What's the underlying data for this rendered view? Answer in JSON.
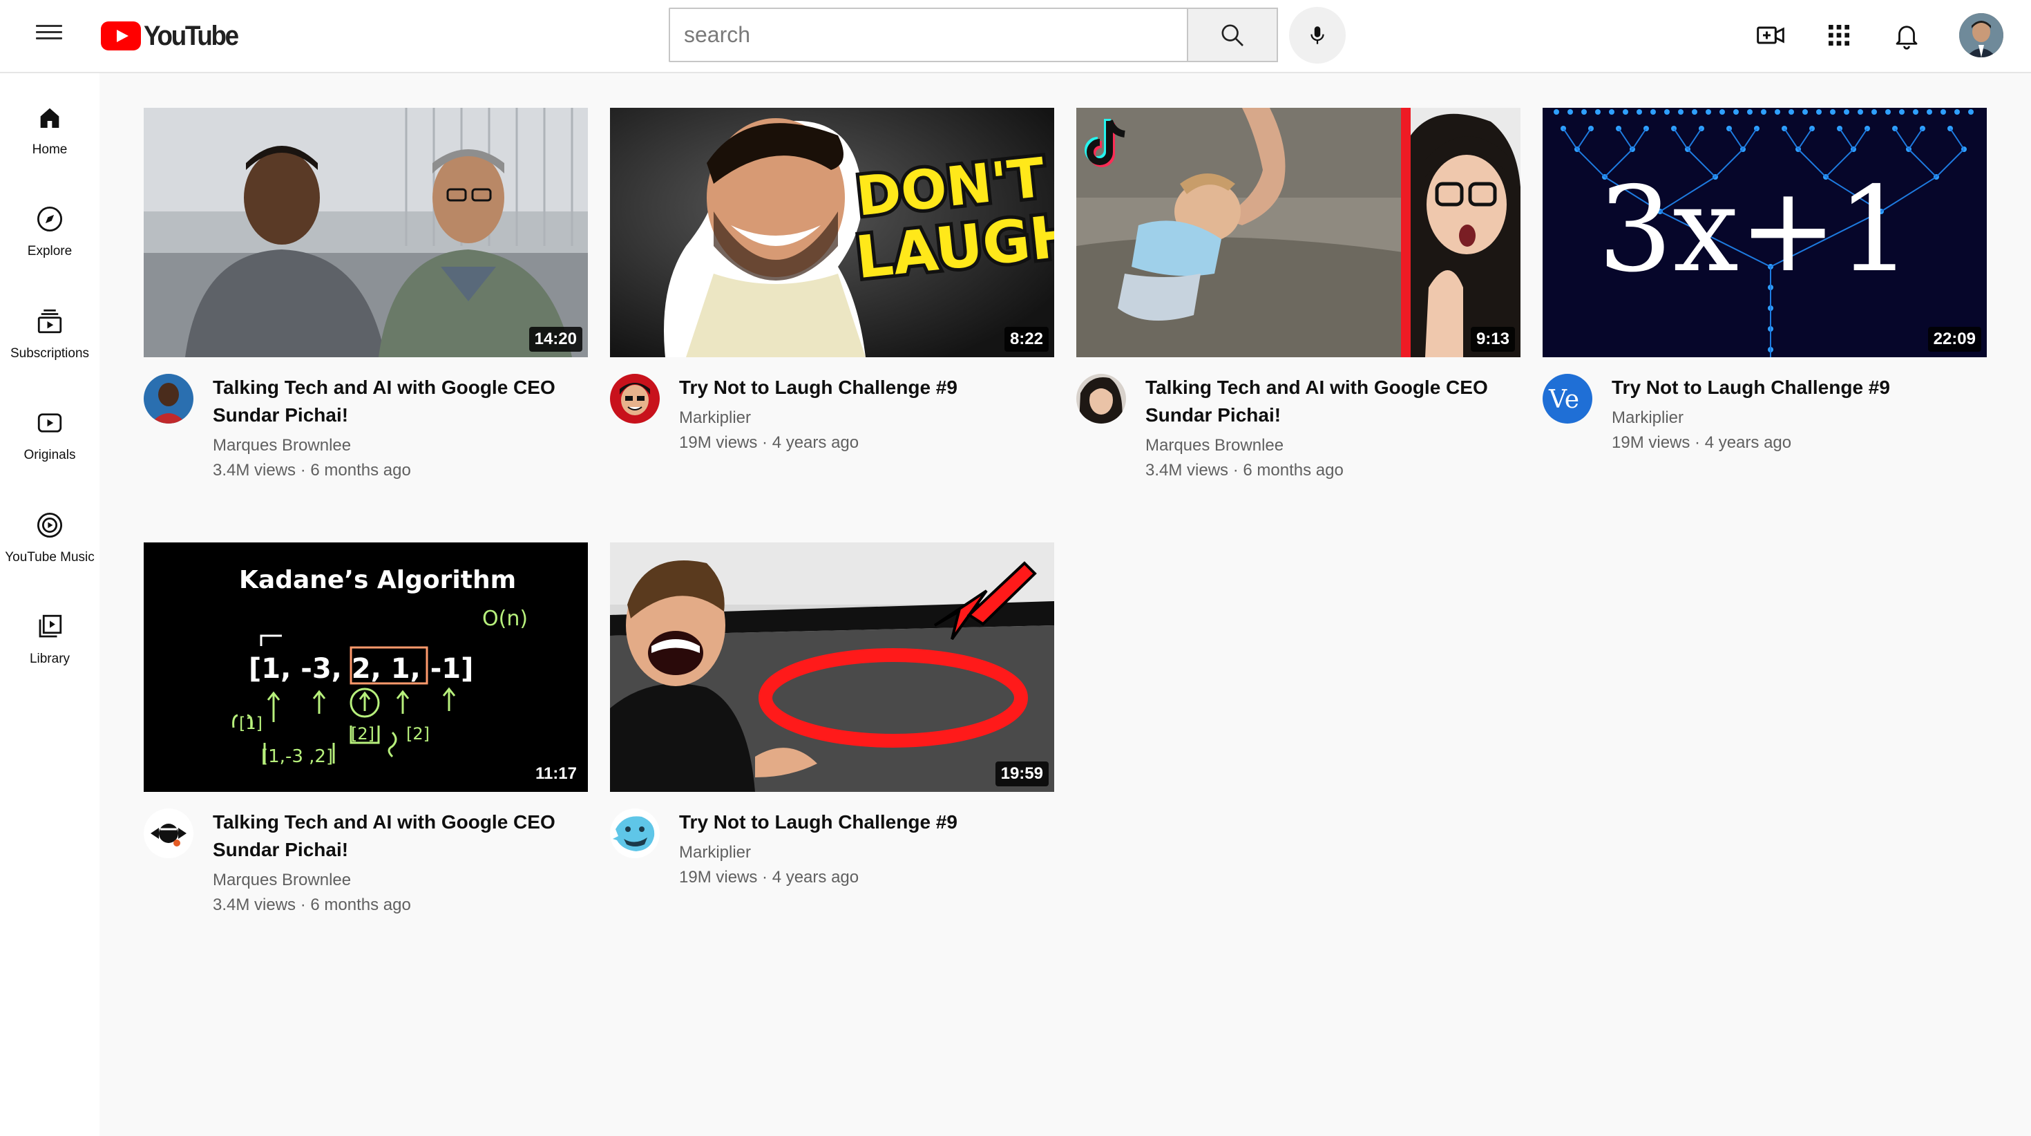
{
  "header": {
    "logo_text": "YouTube",
    "search_placeholder": "search"
  },
  "sidebar": {
    "items": [
      {
        "label": "Home",
        "icon": "home-icon"
      },
      {
        "label": "Explore",
        "icon": "compass-icon"
      },
      {
        "label": "Subscriptions",
        "icon": "subscriptions-icon"
      },
      {
        "label": "Originals",
        "icon": "originals-icon"
      },
      {
        "label": "YouTube Music",
        "icon": "music-icon"
      },
      {
        "label": "Library",
        "icon": "library-icon"
      }
    ]
  },
  "videos": [
    {
      "title_line1": "Talking Tech and AI with Google CEO",
      "title_line2": "Sundar Pichai!",
      "channel": "Marques Brownlee",
      "stats": "3.4M views · 6 months ago",
      "duration": "14:20"
    },
    {
      "title_line1": "Try Not to Laugh Challenge #9",
      "title_line2": "",
      "channel": "Markiplier",
      "stats": "19M views · 4 years ago",
      "duration": "8:22",
      "thumb_text_1": "DON'T",
      "thumb_text_2": "LAUGH"
    },
    {
      "title_line1": "Talking Tech and AI with Google CEO",
      "title_line2": "Sundar Pichai!",
      "channel": "Marques Brownlee",
      "stats": "3.4M views · 6 months ago",
      "duration": "9:13"
    },
    {
      "title_line1": "Try Not to Laugh Challenge #9",
      "title_line2": "",
      "channel": "Markiplier",
      "stats": "19M views · 4 years ago",
      "duration": "22:09",
      "thumb_text_1": "3x+1",
      "avatar_text": "Ve"
    },
    {
      "title_line1": "Talking Tech and AI with Google CEO",
      "title_line2": "Sundar Pichai!",
      "channel": "Marques Brownlee",
      "stats": "3.4M views · 6 months ago",
      "duration": "11:17",
      "thumb_text_1": "Kadane’s Algorithm",
      "thumb_text_2": "[1, -3, 2, 1, -1]",
      "thumb_text_3": "O(n)"
    },
    {
      "title_line1": "Try Not to Laugh Challenge #9",
      "title_line2": "",
      "channel": "Markiplier",
      "stats": "19M views · 4 years ago",
      "duration": "19:59"
    }
  ]
}
